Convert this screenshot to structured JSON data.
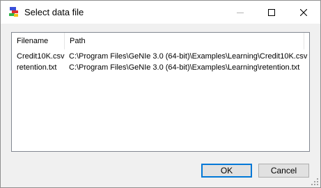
{
  "window": {
    "title": "Select data file",
    "app_icon": "genie-app-icon",
    "controls": [
      "minimize-icon",
      "maximize-icon",
      "close-icon"
    ]
  },
  "list": {
    "columns": [
      {
        "label": "Filename"
      },
      {
        "label": "Path"
      }
    ],
    "rows": [
      {
        "filename": "Credit10K.csv",
        "path": "C:\\Program Files\\GeNIe 3.0 (64-bit)\\Examples\\Learning\\Credit10K.csv"
      },
      {
        "filename": "retention.txt",
        "path": "C:\\Program Files\\GeNIe 3.0 (64-bit)\\Examples\\Learning\\retention.txt"
      }
    ]
  },
  "buttons": {
    "ok": "OK",
    "cancel": "Cancel"
  },
  "colors": {
    "accent": "#0078d7",
    "dialog_bg": "#f0f0f0",
    "titlebar_bg": "#ffffff"
  }
}
